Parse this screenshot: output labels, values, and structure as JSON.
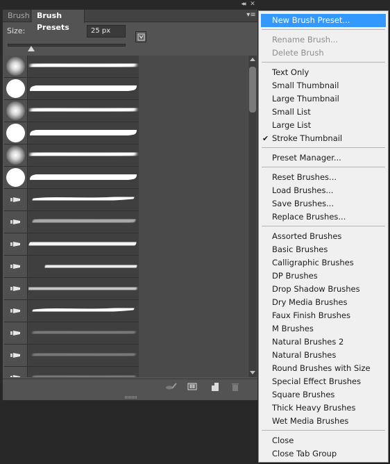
{
  "panel": {
    "collapse_glyph": "◂◂",
    "close_glyph": "✕",
    "tabs": [
      {
        "label": "Brush"
      },
      {
        "label": "Brush Presets"
      }
    ],
    "panel_menu_glyph": "▾≡",
    "size_label": "Size:",
    "size_value": "25 px",
    "size_slider_fraction": 0.2,
    "brushes": [
      {
        "thumb": "soft-round",
        "stroke": "soft"
      },
      {
        "thumb": "hard-round",
        "stroke": "hard"
      },
      {
        "thumb": "soft-round",
        "stroke": "soft"
      },
      {
        "thumb": "hard-round",
        "stroke": "hard"
      },
      {
        "thumb": "soft-round",
        "stroke": "soft"
      },
      {
        "thumb": "hard-round",
        "stroke": "hard"
      },
      {
        "thumb": "tip-icon",
        "stroke": "taper"
      },
      {
        "thumb": "tip-icon",
        "stroke": "dry"
      },
      {
        "thumb": "tip-icon",
        "stroke": "rough"
      },
      {
        "thumb": "tip-icon",
        "stroke": "wide"
      },
      {
        "thumb": "tip-icon",
        "stroke": "bristle"
      },
      {
        "thumb": "tip-icon",
        "stroke": "taper"
      },
      {
        "thumb": "tip-icon",
        "stroke": "faint"
      },
      {
        "thumb": "tip-icon",
        "stroke": "faint"
      },
      {
        "thumb": "tip-icon",
        "stroke": "faint"
      }
    ],
    "bottom_icons": [
      "toggle-brush-panel-icon",
      "grid-icon",
      "new-preset-icon",
      "trash-icon"
    ]
  },
  "menu": {
    "accent": "#3399ff",
    "groups": [
      [
        {
          "label": "New Brush Preset...",
          "state": "highlight"
        }
      ],
      [
        {
          "label": "Rename Brush...",
          "state": "disabled"
        },
        {
          "label": "Delete Brush",
          "state": "disabled"
        }
      ],
      [
        {
          "label": "Text Only"
        },
        {
          "label": "Small Thumbnail"
        },
        {
          "label": "Large Thumbnail"
        },
        {
          "label": "Small List"
        },
        {
          "label": "Large List"
        },
        {
          "label": "Stroke Thumbnail",
          "checked": true
        }
      ],
      [
        {
          "label": "Preset Manager..."
        }
      ],
      [
        {
          "label": "Reset Brushes..."
        },
        {
          "label": "Load Brushes..."
        },
        {
          "label": "Save Brushes..."
        },
        {
          "label": "Replace Brushes..."
        }
      ],
      [
        {
          "label": "Assorted Brushes"
        },
        {
          "label": "Basic Brushes"
        },
        {
          "label": "Calligraphic Brushes"
        },
        {
          "label": "DP Brushes"
        },
        {
          "label": "Drop Shadow Brushes"
        },
        {
          "label": "Dry Media Brushes"
        },
        {
          "label": "Faux Finish Brushes"
        },
        {
          "label": "M Brushes"
        },
        {
          "label": "Natural Brushes 2"
        },
        {
          "label": "Natural Brushes"
        },
        {
          "label": "Round Brushes with Size"
        },
        {
          "label": "Special Effect Brushes"
        },
        {
          "label": "Square Brushes"
        },
        {
          "label": "Thick Heavy Brushes"
        },
        {
          "label": "Wet Media Brushes"
        }
      ],
      [
        {
          "label": "Close"
        },
        {
          "label": "Close Tab Group"
        }
      ]
    ]
  }
}
